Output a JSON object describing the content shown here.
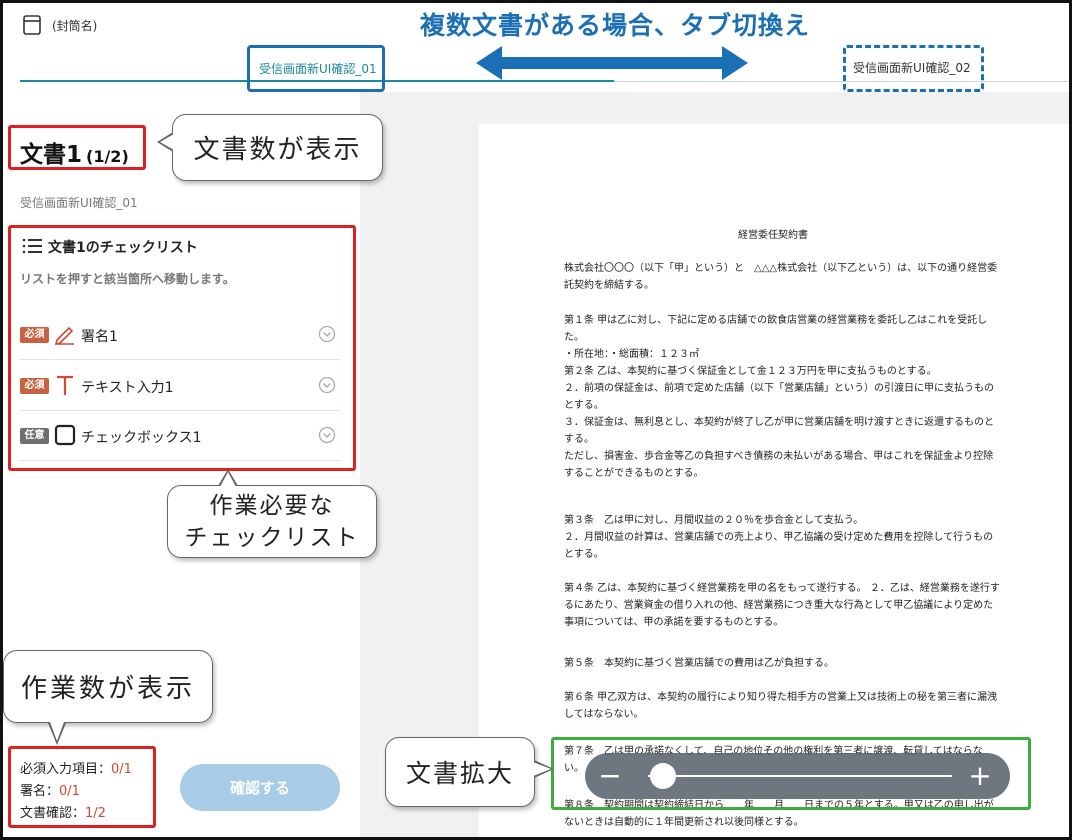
{
  "header": {
    "envelope_name": "(封筒名)",
    "banner": "複数文書がある場合、タブ切換え",
    "tabs": [
      {
        "label": "受信画面新UI確認_01"
      },
      {
        "label": "受信画面新UI確認_02"
      }
    ]
  },
  "left_panel": {
    "doc_title": "文書1",
    "doc_count": "(1/2)",
    "doc_name": "受信画面新UI確認_01",
    "checklist": {
      "title": "文書1のチェックリスト",
      "hint": "リストを押すと該当箇所へ移動します。",
      "items": [
        {
          "badge": "必須",
          "label": "署名1",
          "icon": "pen-icon"
        },
        {
          "badge": "必須",
          "label": "テキスト入力1",
          "icon": "text-t-icon"
        },
        {
          "badge": "任意",
          "label": "チェックボックス1",
          "icon": "checkbox-icon"
        }
      ]
    },
    "progress": {
      "required_label": "必須入力項目：",
      "required_value": "0/1",
      "signature_label": "署名：",
      "signature_value": "0/1",
      "doc_confirm_label": "文書確認：",
      "doc_confirm_value": "1/2"
    },
    "confirm_button": "確認する"
  },
  "callouts": {
    "doc_count": "文書数が表示",
    "checklist_line1": "作業必要な",
    "checklist_line2": "チェックリスト",
    "work_count": "作業数が表示",
    "zoom": "文書拡大"
  },
  "document": {
    "heading": "経営委任契約書",
    "paragraphs": [
      "株式会社〇〇〇（以下「甲」という）と　△△△株式会社（以下乙という）は、以下の通り経営委託契約を締結する。",
      "第１条 甲は乙に対し、下記に定める店舗での飲食店営業の経営業務を委託し乙はこれを受託した。\n・所在地：・総面積：１２３㎡\n第２条 乙は、本契約に基づく保証金として金１２３万円を甲に支払うものとする。\n２．前項の保証金は、前項で定めた店舗（以下「営業店舗」という）の引渡日に甲に支払うものとする。\n３．保証金は、無利息とし、本契約が終了し乙が甲に営業店舗を明け渡すときに返還するものとする。\nただし、損害金、歩合金等乙の負担すべき債務の未払いがある場合、甲はこれを保証金より控除することができるものとする。",
      "第３条　乙は甲に対し、月間収益の２０％を歩合金として支払う。\n２．月間収益の計算は、営業店舗での売上より、甲乙協議の受け定めた費用を控除して行うものとする。",
      "第４条 乙は、本契約に基づく経営業務を甲の名をもって遂行する。 ２．乙は、経営業務を遂行するにあたり、営業資金の借り入れの他、経営業務につき重大な行為として甲乙協議により定めた事項については、甲の承諾を要するものとする。",
      "第５条　本契約に基づく営業店舗での費用は乙が負担する。",
      "第６条 甲乙双方は、本契約の履行により知り得た相手方の営業上又は技術上の秘を第三者に漏洩してはならない。",
      "第７条　乙は甲の承諾なくして、自己の地位その他の権利を第三者に譲渡、転貸してはならない。",
      "第８条　契約期間は契約締結日から　　年　　月　　日までの５年とする。甲又は乙の申し出がないときは自動的に１年間更新され以後同様とする。"
    ]
  },
  "zoom": {
    "minus": "−",
    "plus": "+",
    "level": 0.05
  },
  "colors": {
    "accent": "#1a8a9c",
    "annotation_red": "#e0201e",
    "annotation_blue": "#1b6fb5",
    "annotation_green": "#3cae3c",
    "required_badge": "#c9603f",
    "optional_badge": "#6d6f71",
    "confirm_button": "#a8cbe6"
  }
}
